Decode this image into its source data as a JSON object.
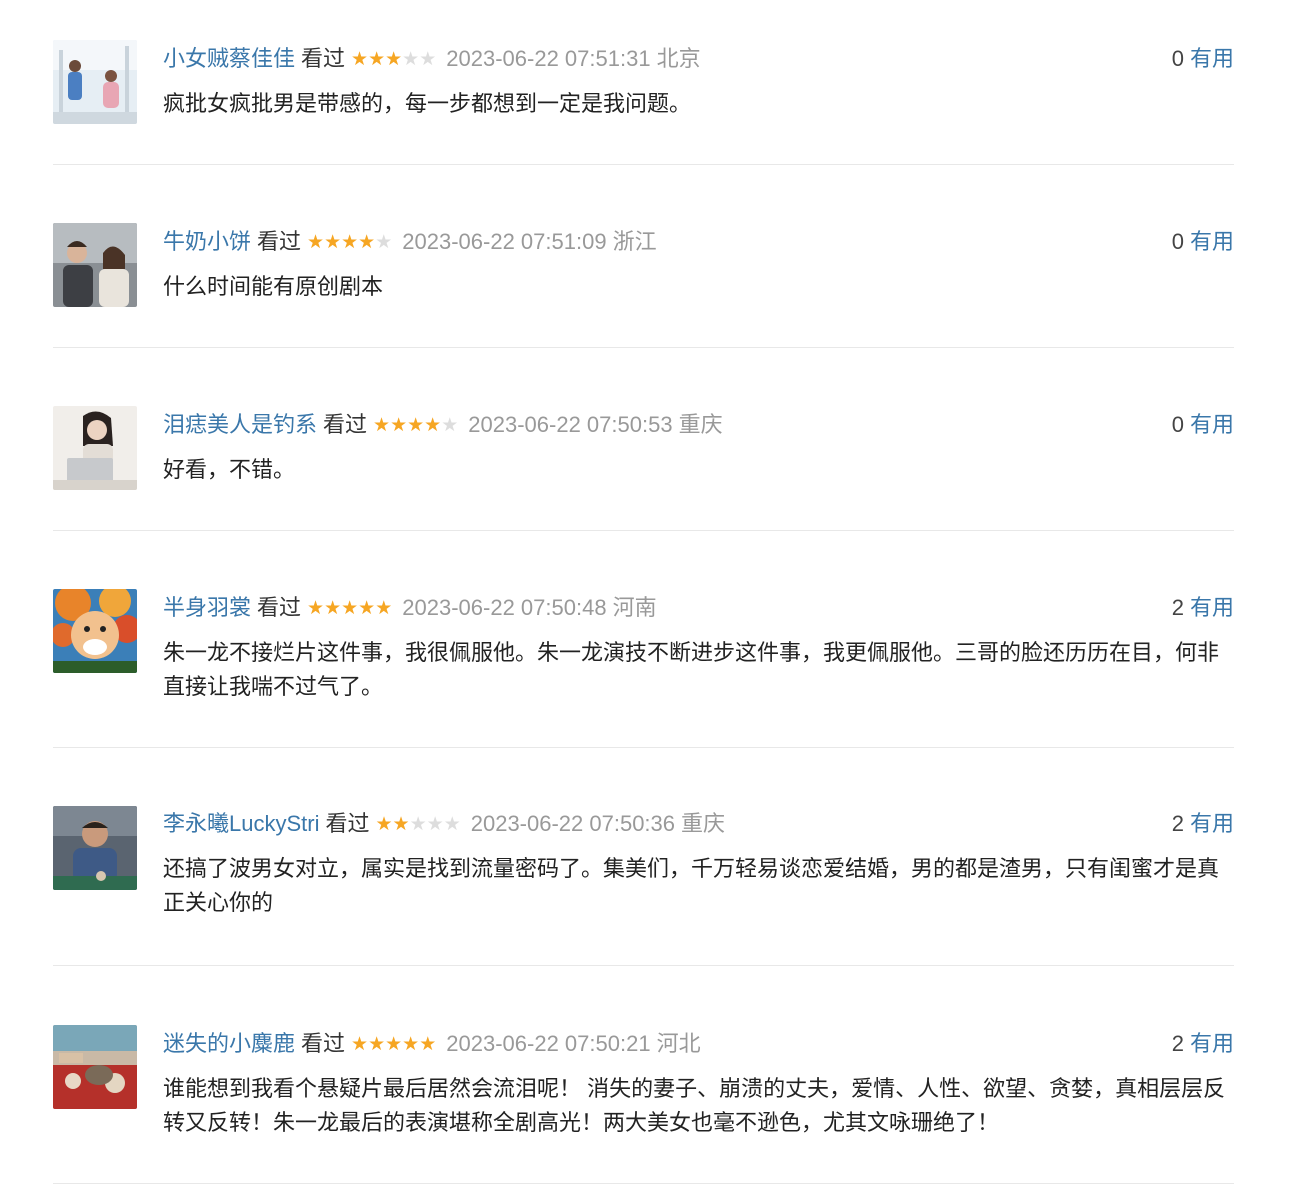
{
  "watched_label": "看过",
  "useful_label": "有用",
  "comments": [
    {
      "user": "小女贼蔡佳佳",
      "rating": 3,
      "time": "2023-06-22 07:51:31",
      "location": "北京",
      "votes": "0",
      "text": "疯批女疯批男是带感的，每一步都想到一定是我问题。"
    },
    {
      "user": "牛奶小饼",
      "rating": 4,
      "time": "2023-06-22 07:51:09",
      "location": "浙江",
      "votes": "0",
      "text": "什么时间能有原创剧本"
    },
    {
      "user": "泪痣美人是钓系",
      "rating": 4,
      "time": "2023-06-22 07:50:53",
      "location": "重庆",
      "votes": "0",
      "text": "好看，不错。"
    },
    {
      "user": "半身羽裳",
      "rating": 5,
      "time": "2023-06-22 07:50:48",
      "location": "河南",
      "votes": "2",
      "text": "朱一龙不接烂片这件事，我很佩服他。朱一龙演技不断进步这件事，我更佩服他。三哥的脸还历历在目，何非直接让我喘不过气了。"
    },
    {
      "user": "李永曦LuckyStri",
      "rating": 2,
      "time": "2023-06-22 07:50:36",
      "location": "重庆",
      "votes": "2",
      "text": "还搞了波男女对立，属实是找到流量密码了。集美们，千万轻易谈恋爱结婚，男的都是渣男，只有闺蜜才是真正关心你的"
    },
    {
      "user": "迷失的小麋鹿",
      "rating": 5,
      "time": "2023-06-22 07:50:21",
      "location": "河北",
      "votes": "2",
      "text": "谁能想到我看个悬疑片最后居然会流泪呢！ 消失的妻子、崩溃的丈夫，爱情、人性、欲望、贪婪，真相层层反转又反转！朱一龙最后的表演堪称全剧高光！两大美女也毫不逊色，尤其文咏珊绝了！"
    }
  ]
}
